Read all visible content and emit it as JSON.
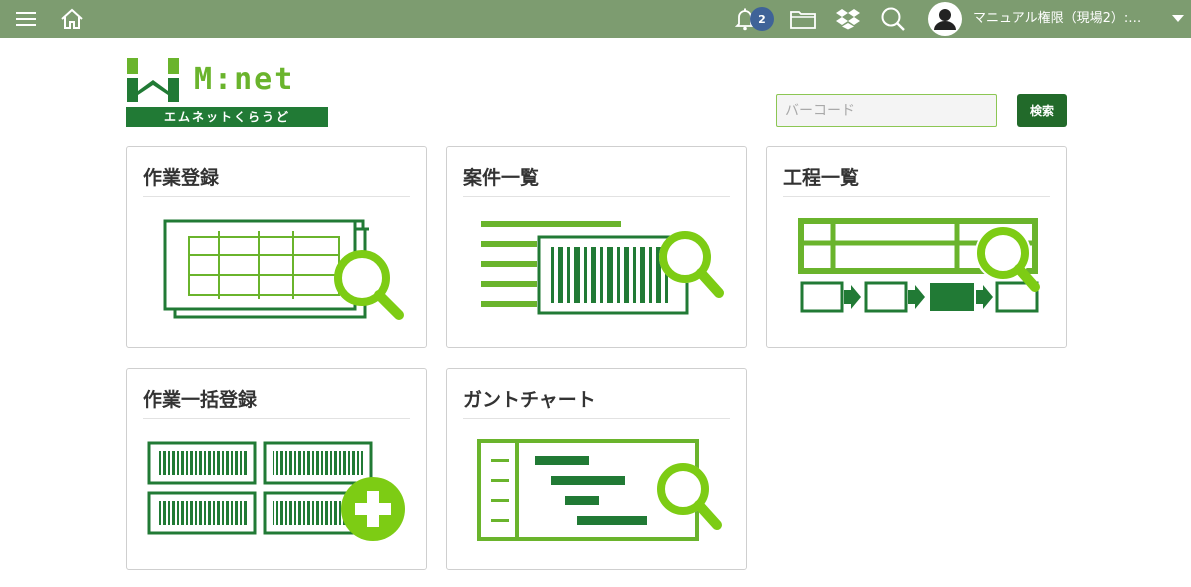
{
  "topbar": {
    "menu_icon": "hamburger-menu-icon",
    "home_icon": "home-icon",
    "notification_icon": "bell-icon",
    "notification_count": "2",
    "folder_icon": "folder-icon",
    "dropbox_icon": "dropbox-icon",
    "search_icon": "search-icon",
    "avatar_icon": "user-avatar-icon",
    "user_name": "マニュアル権限（現場2）:…",
    "dropdown_icon": "caret-down-icon"
  },
  "logo": {
    "wordmark": "M:net",
    "tagline": "エムネットくらうど"
  },
  "barcode_search": {
    "placeholder": "バーコード",
    "value": "",
    "button_label": "検索"
  },
  "cards": [
    {
      "title": "作業登録",
      "icon": "work-register-icon"
    },
    {
      "title": "案件一覧",
      "icon": "project-list-icon"
    },
    {
      "title": "工程一覧",
      "icon": "process-list-icon"
    },
    {
      "title": "作業一括登録",
      "icon": "bulk-register-icon"
    },
    {
      "title": "ガントチャート",
      "icon": "gantt-chart-icon"
    }
  ],
  "colors": {
    "topbar": "#7d9c70",
    "brand_dark_green": "#217a35",
    "brand_light_green": "#6ab42c",
    "icon_lime": "#7dcc14",
    "badge_blue": "#3f6398"
  }
}
